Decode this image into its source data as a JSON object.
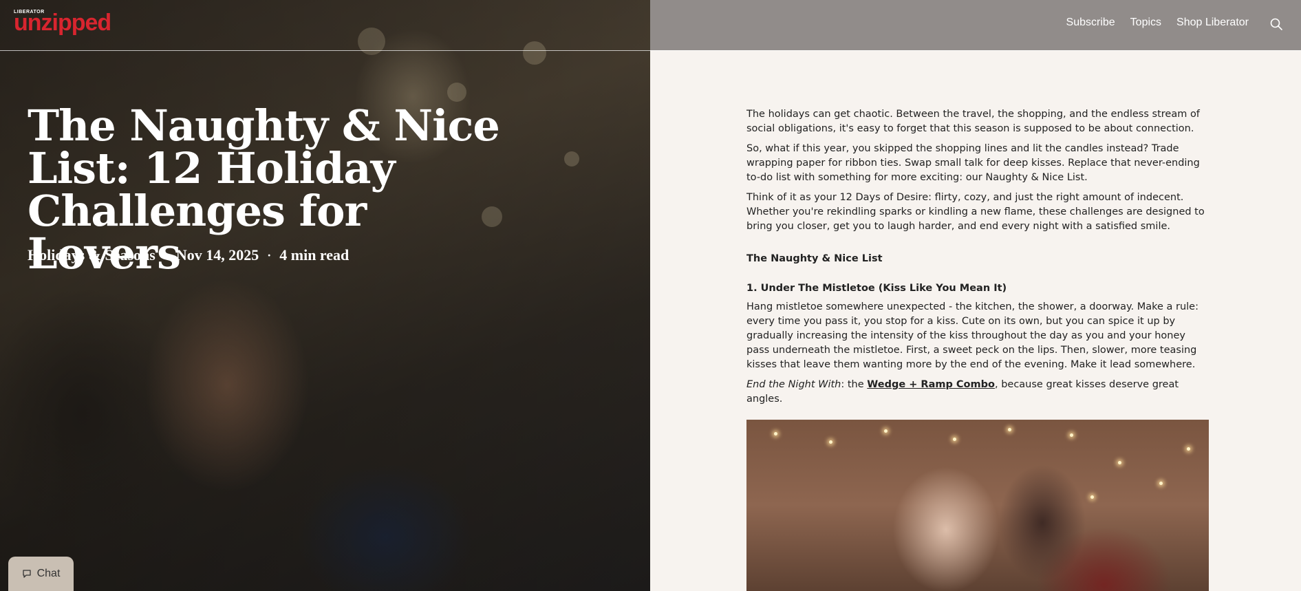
{
  "header": {
    "logo_small": "LIBERATOR",
    "logo_big": "unzipped",
    "nav": [
      "Subscribe",
      "Topics",
      "Shop Liberator"
    ],
    "search_icon": "search-icon"
  },
  "hero": {
    "title": "The Naughty & Nice List: 12 Holiday Challenges for Lovers",
    "category": "Holidays & Seasons",
    "date": "Nov 14, 2025",
    "read_time": "4 min read",
    "separator": "·"
  },
  "article": {
    "p1": "The holidays can get chaotic. Between the travel, the shopping, and the endless stream of social obligations, it's easy to forget that this season is supposed to be about connection.",
    "p2": "So, what if this year, you skipped the shopping lines and lit the candles instead? Trade wrapping paper for ribbon ties. Swap small talk for deep kisses. Replace that never-ending to-do list with something for more exciting: our Naughty & Nice List.",
    "p3": "Think of it as your 12 Days of Desire: flirty, cozy, and just the right amount of indecent. Whether you're rekindling sparks or kindling a new flame, these challenges are designed to bring you closer, get you to laugh harder, and end every night with a satisfied smile.",
    "section_heading": "The Naughty & Nice List",
    "item1_heading": "1. Under The Mistletoe (Kiss Like You Mean It)",
    "item1_body": "Hang mistletoe somewhere unexpected - the kitchen, the shower, a doorway. Make a rule: every time you pass it, you stop for a kiss. Cute on its own, but you can spice it up by gradually increasing the intensity of the kiss throughout the day as you and your honey pass underneath the mistletoe. First, a sweet peck on the lips. Then, slower, more teasing kisses that leave them wanting more by the end of the evening. Make it lead somewhere.",
    "end_label": "End the Night With",
    "end_sep": ": the ",
    "end_link": "Wedge + Ramp Combo",
    "end_rest": ", because great kisses deserve great angles."
  },
  "chat": {
    "label": "Chat",
    "icon": "chat-bubble-icon"
  },
  "colors": {
    "logo_red": "#d8252f",
    "page_bg": "#f7f3ef",
    "header_right": "#918c8a"
  }
}
